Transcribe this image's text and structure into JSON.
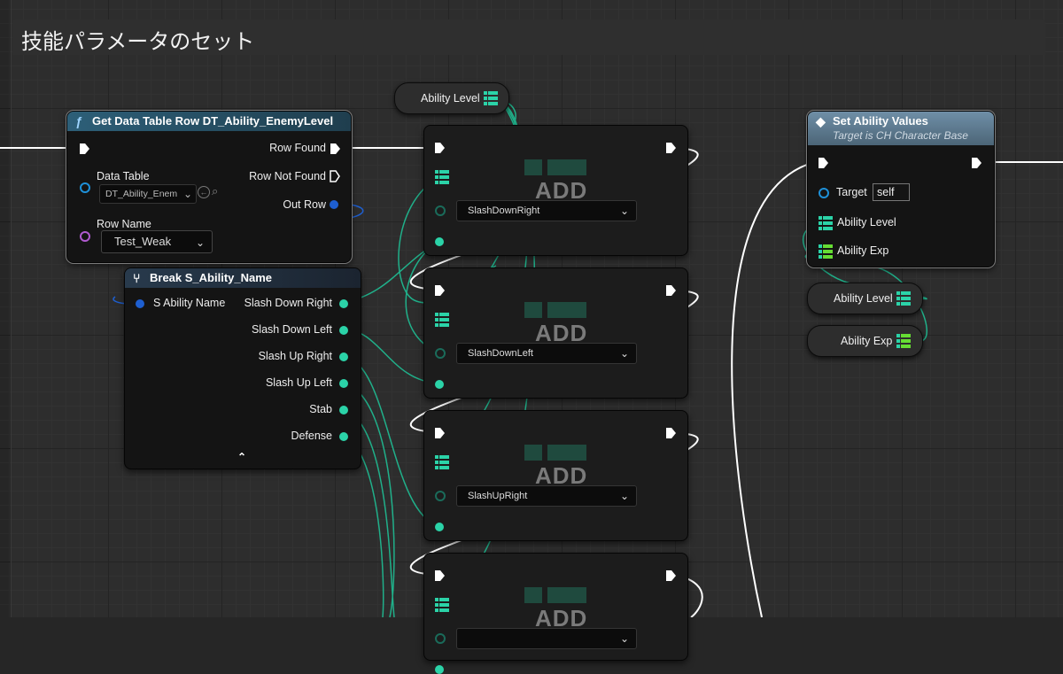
{
  "comment": {
    "title": "技能パラメータのセット"
  },
  "colors": {
    "teal_wire": "#20b08a",
    "exec_wire": "#ffffff",
    "function_header": "#2d5f78",
    "target_blue": "#1e90d8",
    "purple_pin": "#b05ad0"
  },
  "get_row_node": {
    "title": "Get Data Table Row DT_Ability_EnemyLevel",
    "icon": "function-icon",
    "row_found": "Row Found",
    "row_not_found": "Row Not Found",
    "data_table_label": "Data Table",
    "data_table_value": "DT_Ability_Enem",
    "out_row": "Out Row",
    "row_name_label": "Row Name",
    "row_name_value": "Test_Weak"
  },
  "break_node": {
    "title": "Break S_Ability_Name",
    "icon": "break-struct-icon",
    "input": "S Ability Name",
    "outputs": [
      "Slash Down Right",
      "Slash Down Left",
      "Slash Up Right",
      "Slash Up Left",
      "Stab",
      "Defense"
    ]
  },
  "ability_level_var_top": {
    "label": "Ability Level",
    "icon": "map-variable-icon"
  },
  "add_nodes": [
    {
      "label": "ADD",
      "key": "SlashDownRight"
    },
    {
      "label": "ADD",
      "key": "SlashDownLeft"
    },
    {
      "label": "ADD",
      "key": "SlashUpRight"
    },
    {
      "label": "ADD",
      "key": ""
    }
  ],
  "set_node": {
    "title": "Set Ability Values",
    "subtitle": "Target is CH Character Base",
    "icon": "set-function-icon",
    "target_label": "Target",
    "target_value": "self",
    "pins": [
      "Ability Level",
      "Ability Exp"
    ]
  },
  "var_pills_right": [
    {
      "label": "Ability Level",
      "icon": "map-variable-icon"
    },
    {
      "label": "Ability Exp",
      "icon": "map-variable-icon"
    }
  ]
}
